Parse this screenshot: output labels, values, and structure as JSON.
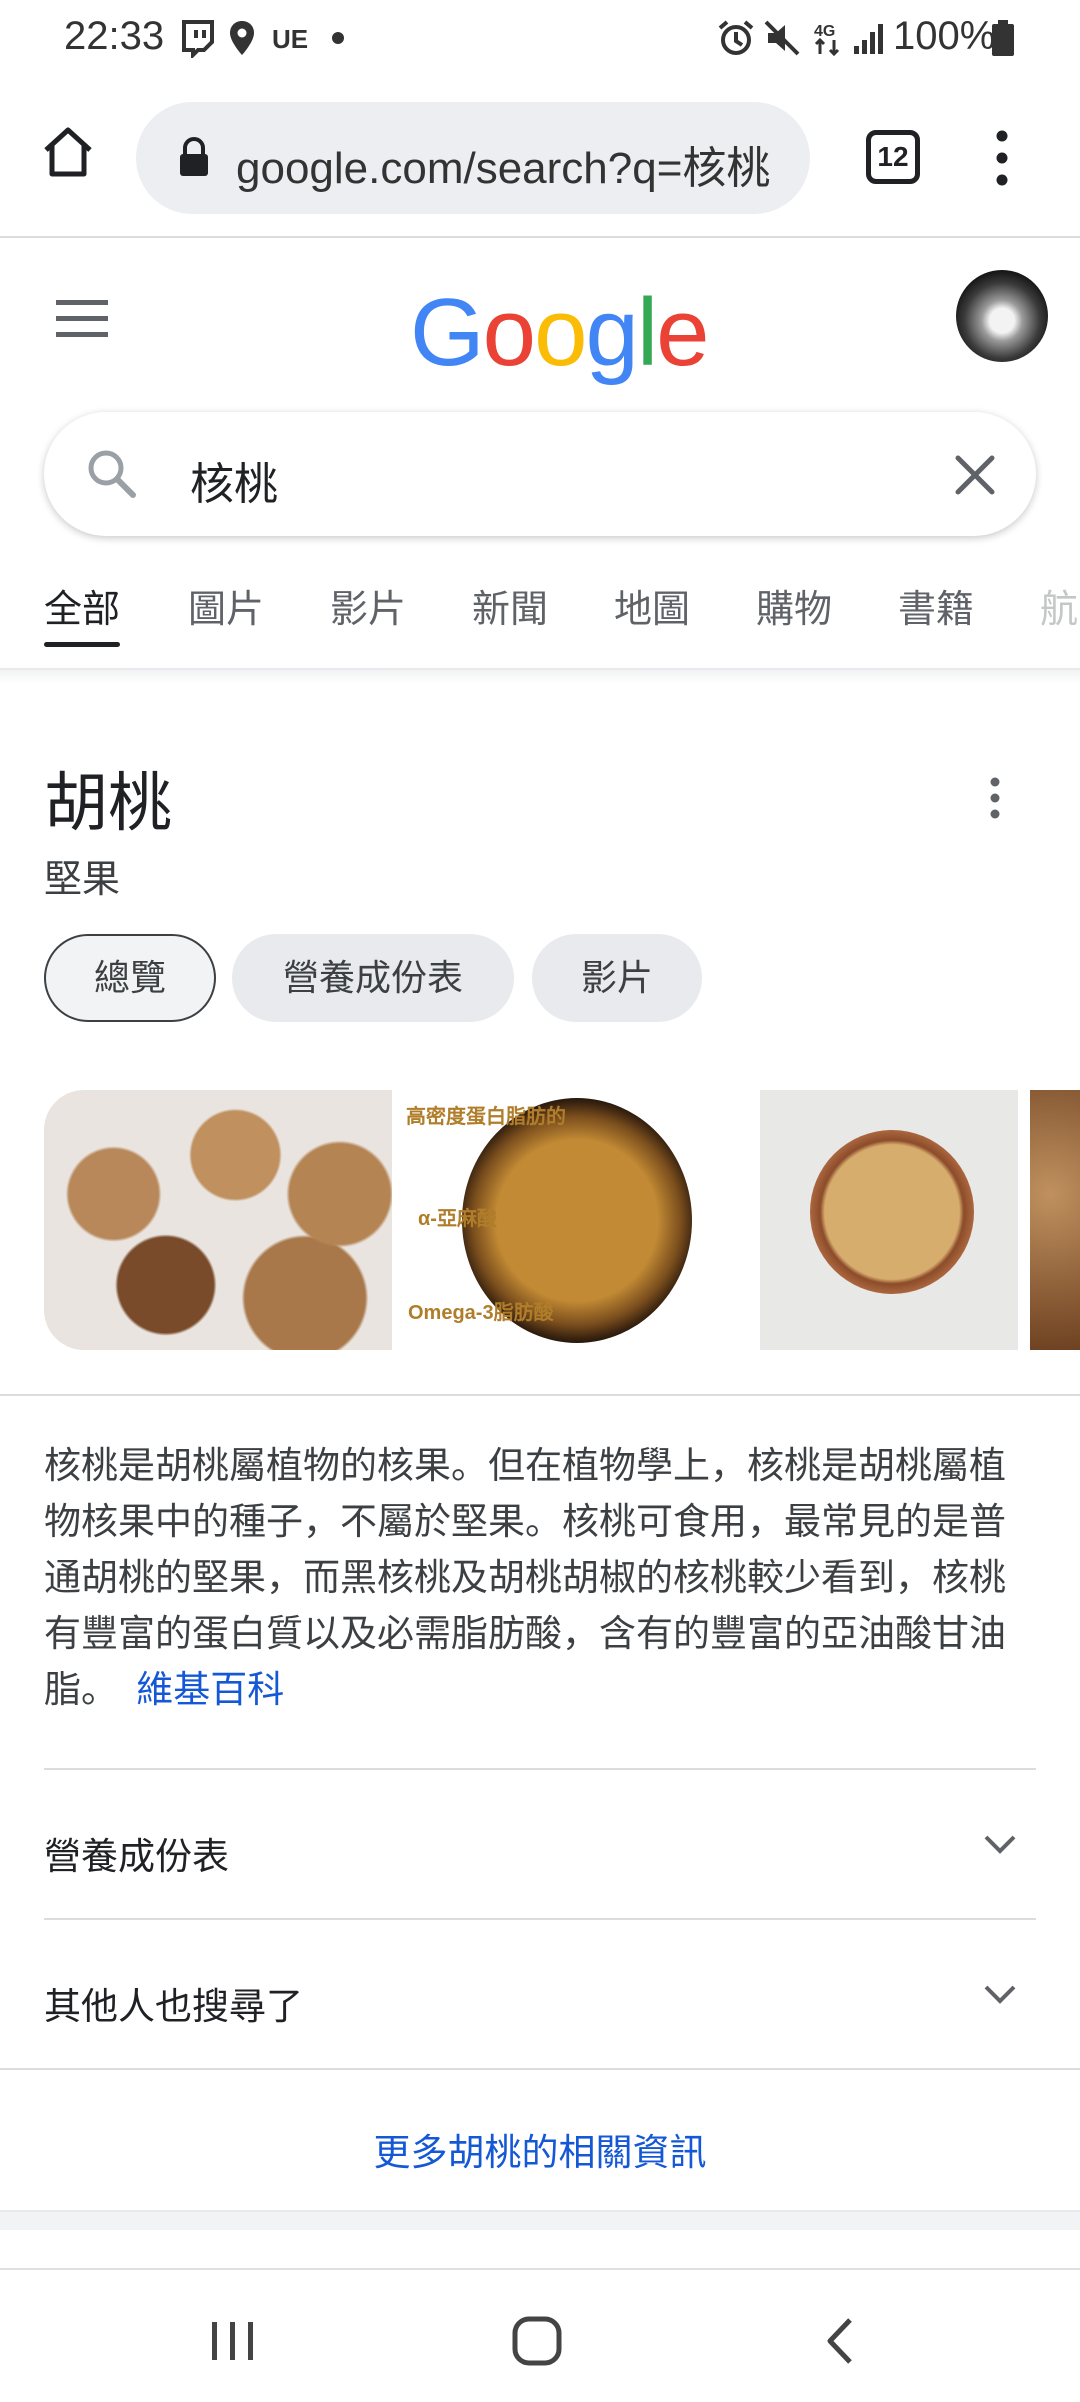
{
  "status_bar": {
    "time": "22:33",
    "battery": "100%",
    "icons": [
      "twitch-icon",
      "location-icon",
      "ue-text",
      "dot-icon",
      "alarm-icon",
      "mute-icon",
      "4g-icon",
      "signal-icon",
      "battery-icon"
    ],
    "carrier_label": "UE"
  },
  "browser": {
    "url": "google.com/search?q=核桃",
    "tab_count": "12"
  },
  "google": {
    "search_query": "核桃",
    "tabs": [
      "全部",
      "圖片",
      "影片",
      "新聞",
      "地圖",
      "購物",
      "書籍",
      "航"
    ]
  },
  "knowledge_panel": {
    "title": "胡桃",
    "subtitle": "堅果",
    "chips": [
      "總覽",
      "營養成份表",
      "影片"
    ],
    "image_overlay": {
      "line1": "高密度蛋白脂肪的",
      "line2": "α-亞麻酸",
      "line3": "Omega-3脂肪酸"
    },
    "description": "核桃是胡桃屬植物的核果。但在植物學上，核桃是胡桃屬植物核果中的種子，不屬於堅果。核桃可食用，最常見的是普通胡桃的堅果，而黑核桃及胡桃胡椒的核桃較少看到，核桃有豐富的蛋白質以及必需脂肪酸，含有的豐富的亞油酸甘油脂。",
    "description_link": "維基百科",
    "expanders": [
      "營養成份表",
      "其他人也搜尋了"
    ],
    "more_link": "更多胡桃的相關資訊"
  },
  "colors": {
    "google_blue": "#4285F4",
    "google_red": "#EA4335",
    "google_yellow": "#FBBC05",
    "google_green": "#34A853",
    "link_blue": "#1558D6"
  }
}
